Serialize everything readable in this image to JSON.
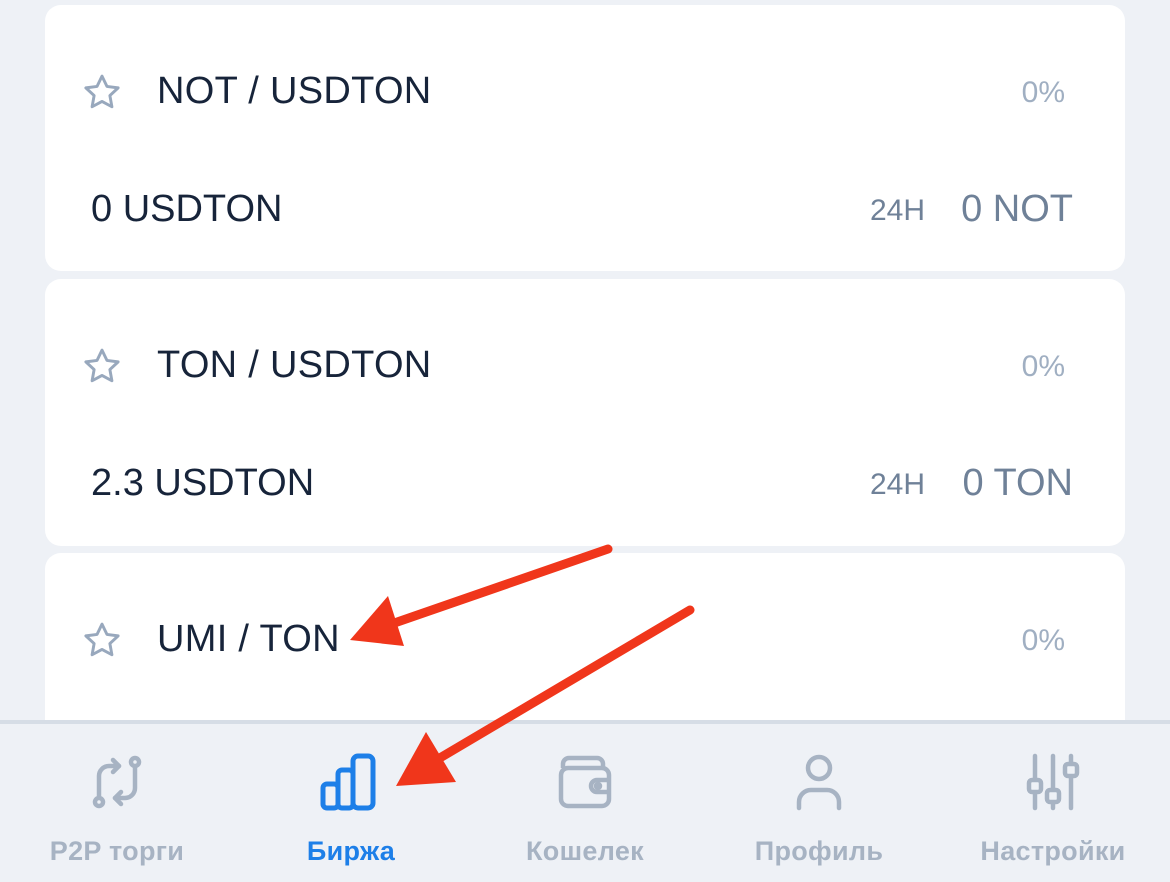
{
  "markets": [
    {
      "pair": "NOT / USDTON",
      "change": "0%",
      "price": "0 USDTON",
      "period": "24H",
      "volume": "0 NOT"
    },
    {
      "pair": "TON / USDTON",
      "change": "0%",
      "price": "2.3 USDTON",
      "period": "24H",
      "volume": "0 TON"
    },
    {
      "pair": "UMI / TON",
      "change": "0%"
    }
  ],
  "nav": {
    "items": [
      {
        "label": "P2P торги",
        "icon": "p2p-swap-icon",
        "active": false
      },
      {
        "label": "Биржа",
        "icon": "exchange-chart-icon",
        "active": true
      },
      {
        "label": "Кошелек",
        "icon": "wallet-icon",
        "active": false
      },
      {
        "label": "Профиль",
        "icon": "profile-icon",
        "active": false
      },
      {
        "label": "Настройки",
        "icon": "settings-sliders-icon",
        "active": false
      }
    ]
  },
  "colors": {
    "background": "#eef1f6",
    "card": "#ffffff",
    "text_primary": "#17243a",
    "text_muted": "#a0afc2",
    "accent": "#1d7fe8",
    "nav_inactive": "#a7b3c3",
    "annotation_arrow": "#f0361b"
  }
}
